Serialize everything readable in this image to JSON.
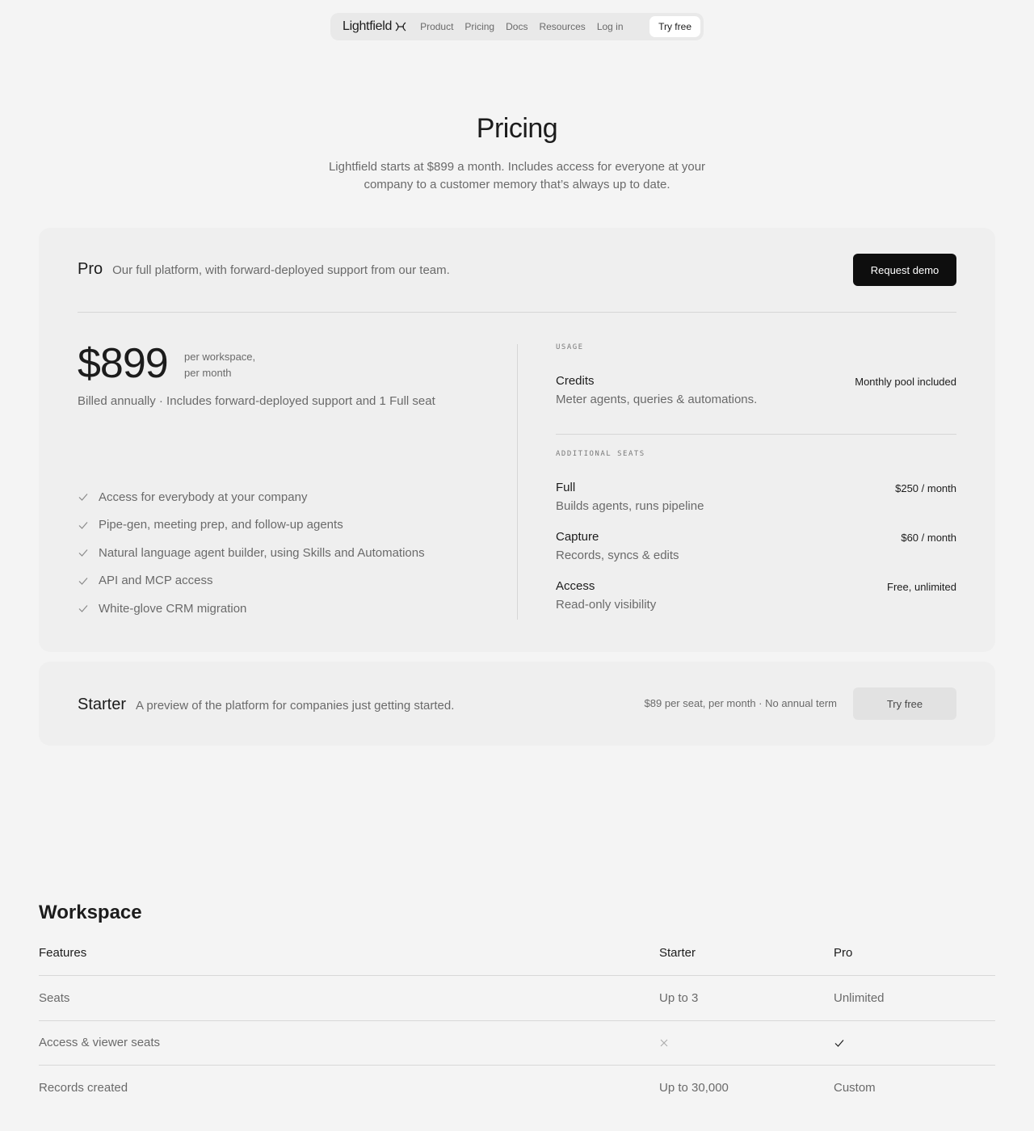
{
  "nav": {
    "logo": "Lightfield",
    "links": [
      "Product",
      "Pricing",
      "Docs",
      "Resources",
      "Log in"
    ],
    "cta": "Try free"
  },
  "hero": {
    "title": "Pricing",
    "subtitle": "Lightfield starts at $899 a month. Includes access for everyone at your company to a customer memory that’s always up to date."
  },
  "pro": {
    "name": "Pro",
    "description": "Our full platform, with forward-deployed support from our team.",
    "cta": "Request demo",
    "price": "$899",
    "price_unit_line1": "per workspace,",
    "price_unit_line2": "per month",
    "billing": "Billed annually · Includes forward-deployed support and 1 Full seat",
    "features": [
      "Access for everybody at your company",
      "Pipe-gen, meeting prep, and follow-up agents",
      "Natural language agent builder, using Skills and Automations",
      "API and MCP access",
      "White-glove CRM migration"
    ],
    "usage": {
      "label": "USAGE",
      "items": [
        {
          "name": "Credits",
          "desc": "Meter agents, queries & automations.",
          "value": "Monthly pool included"
        }
      ]
    },
    "seats": {
      "label": "ADDITIONAL SEATS",
      "items": [
        {
          "name": "Full",
          "desc": "Builds agents, runs pipeline",
          "value": "$250 / month"
        },
        {
          "name": "Capture",
          "desc": "Records, syncs & edits",
          "value": "$60 / month"
        },
        {
          "name": "Access",
          "desc": "Read-only visibility",
          "value": "Free, unlimited"
        }
      ]
    }
  },
  "starter": {
    "name": "Starter",
    "description": "A preview of the platform for companies just getting started.",
    "meta": "$89 per seat, per month · No annual term",
    "cta": "Try free"
  },
  "workspace": {
    "title": "Workspace",
    "headers": [
      "Features",
      "Starter",
      "Pro"
    ],
    "rows": [
      {
        "feature": "Seats",
        "starter": "Up to 3",
        "pro": "Unlimited"
      },
      {
        "feature": "Access & viewer seats",
        "starter": "x-icon",
        "pro": "check-icon"
      },
      {
        "feature": "Records created",
        "starter": "Up to 30,000",
        "pro": "Custom"
      }
    ]
  }
}
